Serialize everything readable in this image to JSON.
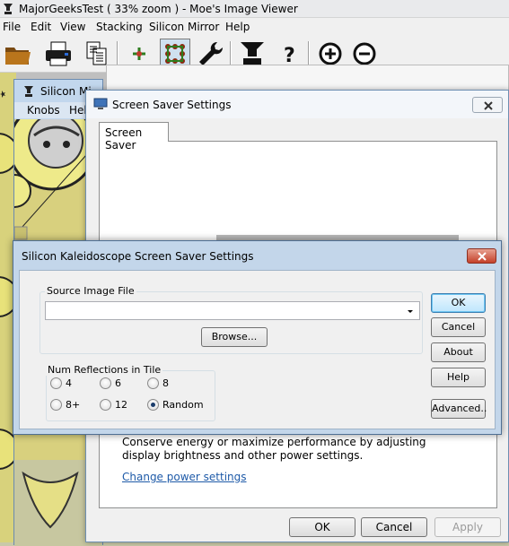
{
  "main_window": {
    "title": "MajorGeeksTest ( 33% zoom ) - Moe's Image Viewer",
    "menu": [
      "File",
      "Edit",
      "View",
      "Stacking",
      "Silicon Mirror",
      "Help"
    ],
    "toolbar_icons": [
      "open-folder-icon",
      "print-icon",
      "copy-icon",
      "crosshair-icon",
      "grid-dots-icon",
      "wrench-icon",
      "anvil-icon",
      "help-question-icon",
      "zoom-in-icon",
      "zoom-out-icon"
    ]
  },
  "mirror_window": {
    "title": "Silicon Mi",
    "menu": [
      "Knobs",
      "Hel"
    ]
  },
  "screensaver_dialog": {
    "title": "Screen Saver Settings",
    "tab_label": "Screen Saver",
    "power_text": "Conserve energy or maximize performance by adjusting display brightness and other power settings.",
    "power_link": "Change power settings",
    "ok_label": "OK",
    "cancel_label": "Cancel",
    "apply_label": "Apply"
  },
  "kaleido_dialog": {
    "title": "Silicon Kaleidoscope Screen Saver Settings",
    "source_group_label": "Source Image File",
    "source_value": "",
    "browse_label": "Browse...",
    "reflections_group_label": "Num Reflections in Tile",
    "reflection_options": [
      "4",
      "6",
      "8",
      "8+",
      "12",
      "Random"
    ],
    "selected_reflection": "Random",
    "buttons": {
      "ok": "OK",
      "cancel": "Cancel",
      "about": "About",
      "help": "Help",
      "advanced": "Advanced.."
    }
  },
  "colors": {
    "kaleido_frame": "#c3d6ea",
    "close_red": "#c4412a",
    "link_blue": "#1e5aa8",
    "art_yellow": "#d6d08a"
  }
}
